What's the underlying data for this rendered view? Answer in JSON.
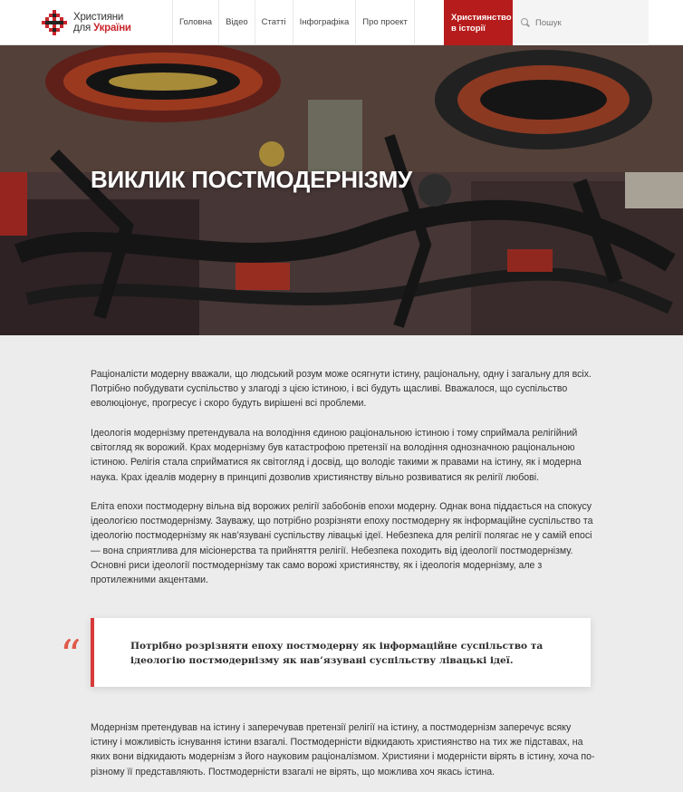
{
  "logo": {
    "line1": "Християни",
    "line2_a": "для",
    "line2_b": "України"
  },
  "nav": {
    "items": [
      {
        "label": "Головна"
      },
      {
        "label": "Відео"
      },
      {
        "label": "Статті"
      },
      {
        "label": "Інфографіка"
      },
      {
        "label": "Про проект"
      }
    ],
    "highlight": {
      "line1": "Християнство",
      "line2": "в історії"
    }
  },
  "search": {
    "placeholder": "Пошук"
  },
  "hero": {
    "title": "ВИКЛИК ПОСТМОДЕРНІЗМУ"
  },
  "article": {
    "p1": "Раціоналісти модерну вважали, що людський розум може осягнути істину, раціональну, одну і загальну для всіх. Потрібно побудувати суспільство у злагоді з цією істиною, і всі будуть щасливі. Вважалося, що суспільство еволюціонує, прогресує і скоро будуть вирішені всі проблеми.",
    "p2": "Ідеологія модернізму претендувала на володіння єдиною раціональною істиною і тому сприймала релігійний світогляд як ворожий. Крах модернізму був катастрофою претензії на володіння однозначною раціональною істиною. Релігія стала сприйматися як світогляд і досвід, що володіє такими ж правами на істину, як і модерна наука. Крах ідеалів модерну в принципі дозволив християнству вільно розвиватися як релігії любові.",
    "p3": "Еліта епохи постмодерну вільна від ворожих релігії забобонів епохи модерну. Однак вона піддається на спокусу ідеологією постмодернізму. Зауважу, що потрібно розрізняти епоху постмодерну як інформаційне суспільство та ідеологію постмодернізму як нав’язувані суспільству лівацькі ідеї. Небезпека для релігії полягає не у самій епосі — вона сприятлива для місіонерства та прийняття релігії. Небезпека походить від ідеології постмодернізму. Основні риси ідеології постмодернізму так само ворожі християнству, як і ідеологія модернізму, але з протилежними акцентами.",
    "quote_mark": "“",
    "quote": "Потрібно розрізняти епоху постмодерну як інформаційне суспільство та ідеологію постмодернізму як нав’язувані суспільству лівацькі ідеї.",
    "p4": "Модернізм претендував на істину і заперечував претензії релігії на істину, а постмодернізм заперечує всяку істину і можливість існування істини взагалі. Постмодерністи відкидають християнство на тих же підставах, на яких вони відкидають модернізм з його науковим раціоналізмом. Християни і модерністи вірять в істину, хоча по-різному її представляють. Постмодерністи взагалі не вірять, що можлива хоч якась істина."
  },
  "colors": {
    "accent": "#b71c1c",
    "quote_border": "#d83a3a",
    "quote_mark": "#e05a4a"
  }
}
